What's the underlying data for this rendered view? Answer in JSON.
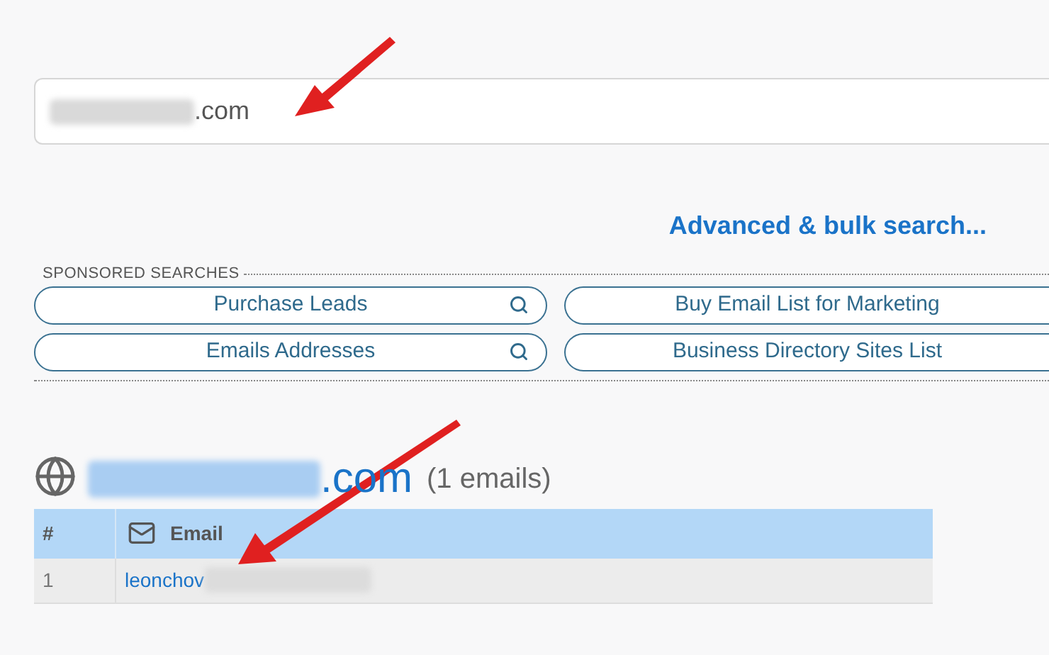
{
  "search": {
    "value": ".com"
  },
  "advanced_link": "Advanced & bulk search...",
  "sponsored": {
    "title": "SPONSORED SEARCHES",
    "items": [
      "Purchase Leads",
      "Buy Email List for Marketing",
      "Emails Addresses",
      "Business Directory Sites List"
    ]
  },
  "result": {
    "domain": ".com",
    "count": "(1 emails)",
    "table": {
      "columns": [
        "#",
        "Email"
      ],
      "rows": [
        [
          "1",
          "leonchov"
        ]
      ]
    }
  }
}
